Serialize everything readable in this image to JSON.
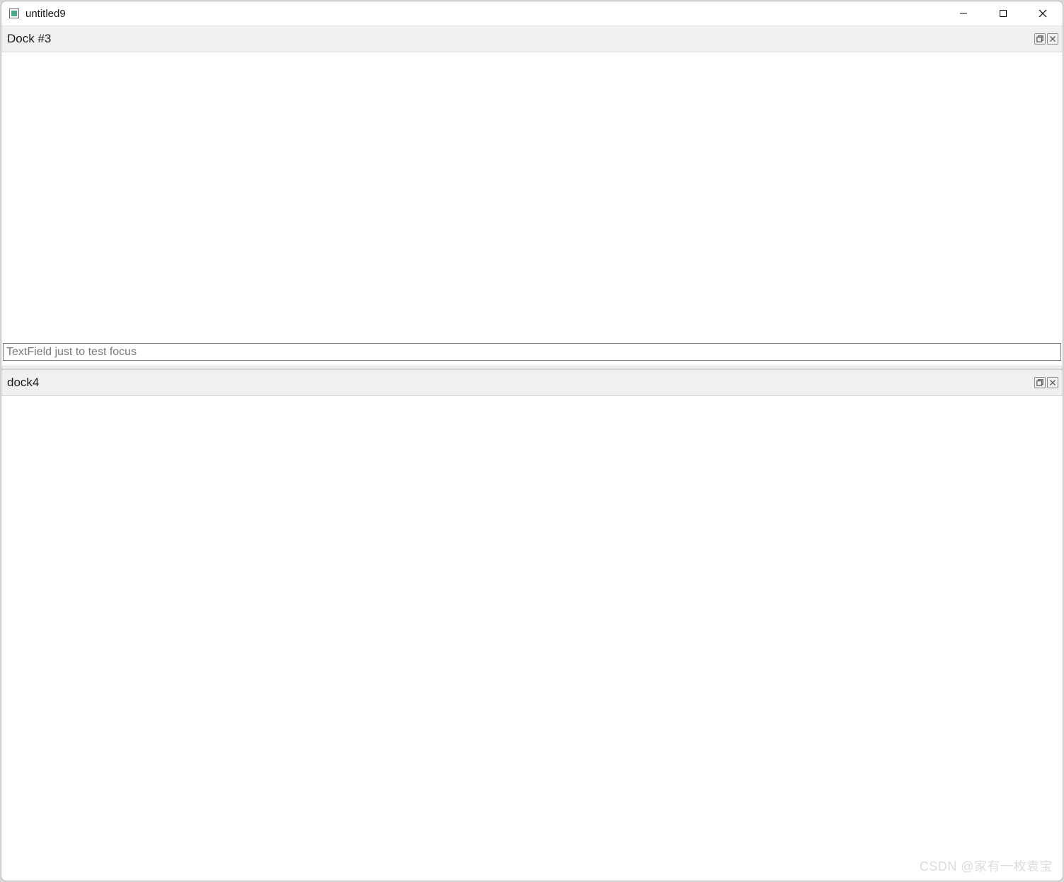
{
  "window": {
    "title": "untitled9"
  },
  "docks": {
    "top": {
      "title": "Dock #3",
      "textfield_placeholder": "TextField just to test focus",
      "textfield_value": ""
    },
    "bottom": {
      "title": "dock4"
    }
  },
  "watermark": "CSDN @家有一枚袁宝"
}
